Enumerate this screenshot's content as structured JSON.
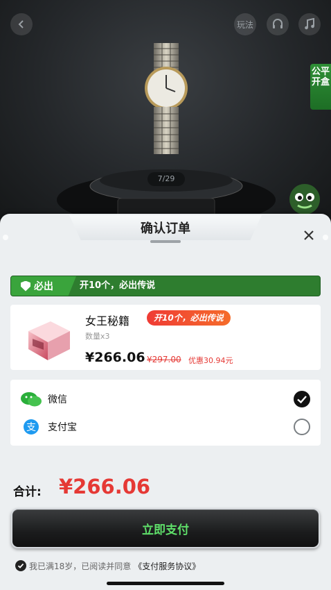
{
  "stage": {
    "rules_label": "玩法",
    "fair_tag": "公平开盒",
    "counter": "7/29"
  },
  "sheet": {
    "title": "确认订单",
    "guarantee": {
      "badge": "必出",
      "text": "开10个，必出传说"
    },
    "product": {
      "name": "女王秘籍",
      "tag": "开10个，必出传说",
      "quantity": "数量x3",
      "price": "¥266.06",
      "original_price": "¥297.00",
      "discount": "优惠30.94元"
    },
    "payment": {
      "wechat_label": "微信",
      "alipay_label": "支付宝",
      "selected": "wechat"
    },
    "total": {
      "label": "合计:",
      "amount": "¥266.06"
    },
    "pay_button": "立即支付",
    "agreement": {
      "text": "我已满18岁，已阅读并同意",
      "link": "《支付服务协议》"
    }
  },
  "colors": {
    "accent_green": "#2e7d2f",
    "price_red": "#e53935",
    "button_text_green": "#5fe06a"
  }
}
